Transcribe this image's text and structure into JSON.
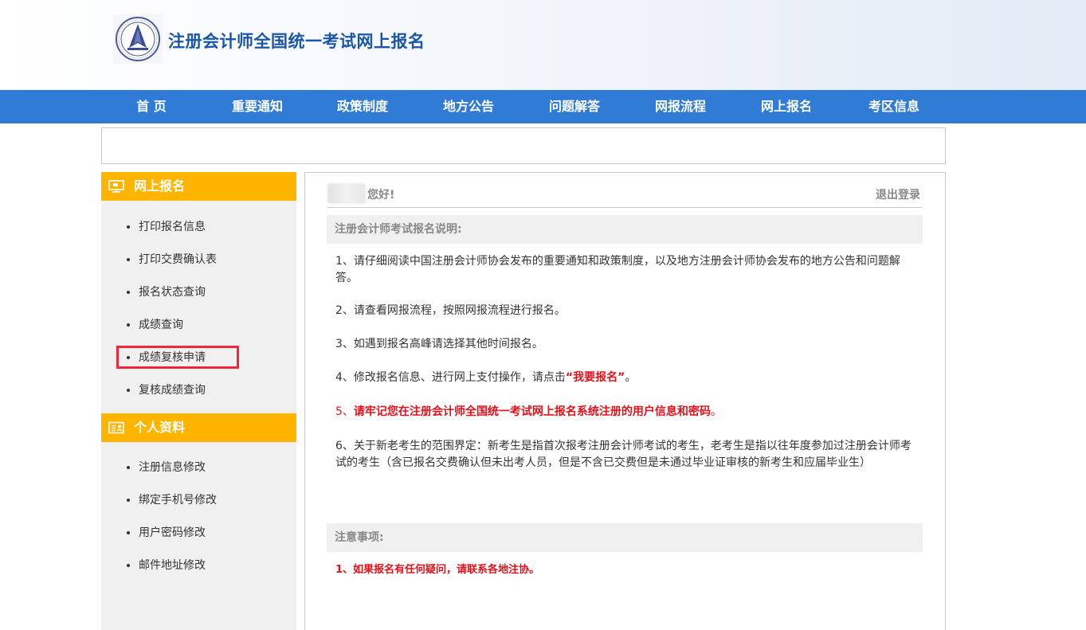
{
  "header": {
    "site_title": "注册会计师全国统一考试网上报名",
    "logo_icon": "cicpa-seal-logo"
  },
  "nav": {
    "items": [
      {
        "label": "首 页"
      },
      {
        "label": "重要通知"
      },
      {
        "label": "政策制度"
      },
      {
        "label": "地方公告"
      },
      {
        "label": "问题解答"
      },
      {
        "label": "网报流程"
      },
      {
        "label": "网上报名"
      },
      {
        "label": "考区信息"
      }
    ]
  },
  "sidebar": {
    "section1": {
      "title": "网上报名",
      "icon": "monitor-icon",
      "items": [
        {
          "label": "打印报名信息"
        },
        {
          "label": "打印交费确认表"
        },
        {
          "label": "报名状态查询"
        },
        {
          "label": "成绩查询"
        },
        {
          "label": "成绩复核申请"
        },
        {
          "label": "复核成绩查询"
        }
      ]
    },
    "section2": {
      "title": "个人资料",
      "icon": "id-card-icon",
      "items": [
        {
          "label": "注册信息修改"
        },
        {
          "label": "绑定手机号修改"
        },
        {
          "label": "用户密码修改"
        },
        {
          "label": "邮件地址修改"
        }
      ]
    }
  },
  "main": {
    "greeting": "您好!",
    "logout_label": "退出登录",
    "instructions_title": "注册会计师考试报名说明:",
    "p1": "1、请仔细阅读中国注册会计师协会发布的重要通知和政策制度，以及地方注册会计师协会发布的地方公告和问题解答。",
    "p2": "2、请查看网报流程，按照网报流程进行报名。",
    "p3": "3、如遇到报名高峰请选择其他时间报名。",
    "p4_prefix": "4、修改报名信息、进行网上支付操作，请点击",
    "p4_link": "“我要报名”",
    "p4_suffix": "。",
    "p5_prefix": "5、",
    "p5_text": "请牢记您在注册会计师全国统一考试网上报名系统注册的用户信息和密码",
    "p5_suffix": "。",
    "p6": "6、关于新老考生的范围界定：新考生是指首次报考注册会计师考试的考生，老考生是指以往年度参加过注册会计师考试的考生（含已报名交费确认但未出考人员，但是不含已交费但是未通过毕业证审核的新考生和应届毕业生）",
    "notes_title": "注意事项:",
    "note1": "1、如果报名有任何疑问，请联系各地注协。"
  },
  "colors": {
    "nav_blue": "#2f7bd5",
    "title_blue": "#1a57a8",
    "sidebar_orange": "#ffb400",
    "alert_red": "#e4111b",
    "highlight_red": "#ee2a3a"
  }
}
